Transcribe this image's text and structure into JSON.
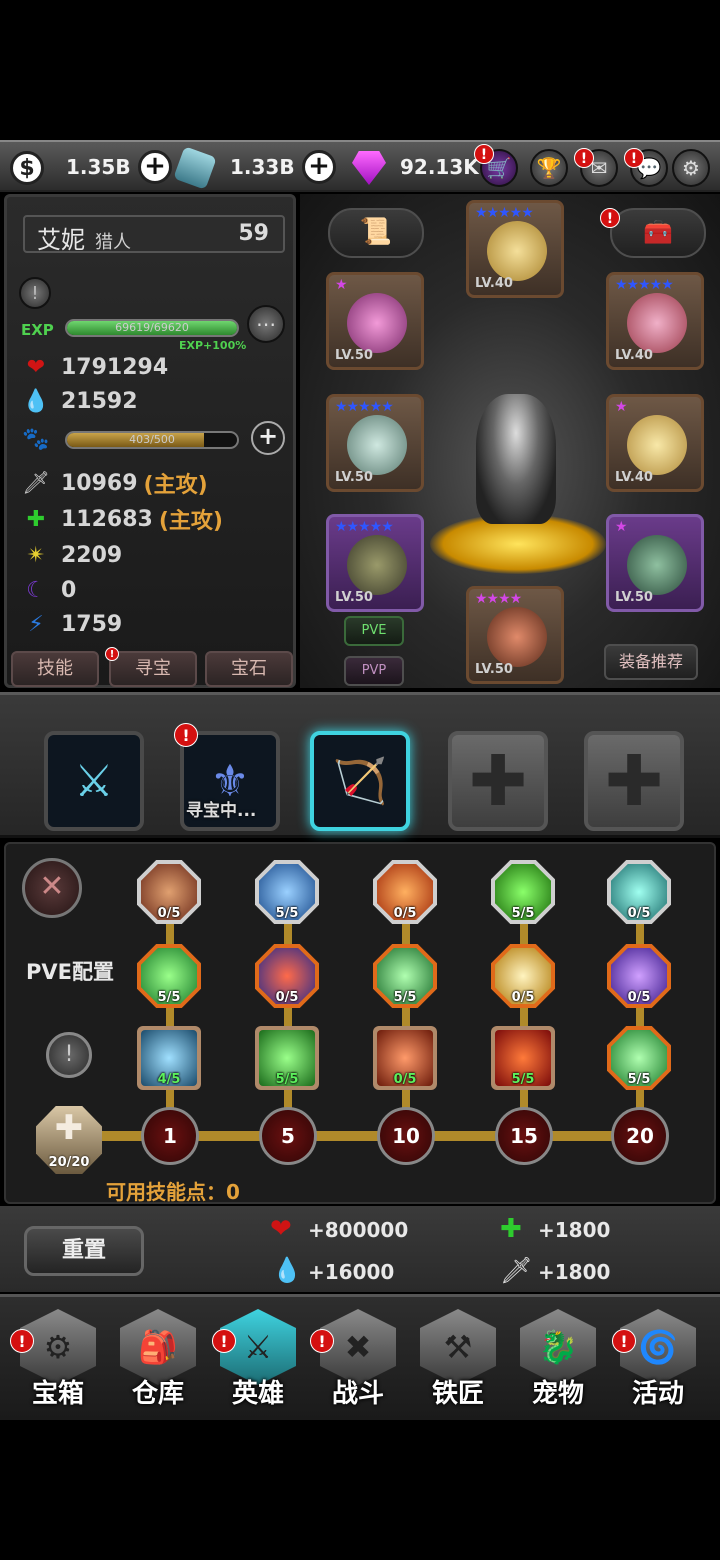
{
  "currency": {
    "gold": "1.35B",
    "crystal": "1.33B",
    "gem": "92.13K"
  },
  "hero": {
    "name": "艾妮",
    "class": "猎人",
    "level": "59",
    "exp_label": "EXP",
    "exp_value": "69619/69620",
    "exp_bonus": "EXP+100%",
    "exp_fraction": 1.0,
    "hp": "1791294",
    "mp": "21592",
    "pet_value": "403/500",
    "pet_fraction": 0.806,
    "attack": "10969",
    "attack_tag": "(主攻)",
    "magic": "112683",
    "magic_tag": "(主攻)",
    "crit": "2209",
    "dark": "0",
    "speed": "1759"
  },
  "stat_tabs": [
    "技能",
    "寻宝",
    "宝石"
  ],
  "equipment": {
    "slots": [
      {
        "lv": "LV.40",
        "stars": "★★★★★"
      },
      {
        "lv": "LV.50",
        "stars": "★"
      },
      {
        "lv": "LV.40",
        "stars": "★★★★★"
      },
      {
        "lv": "LV.50",
        "stars": "★★★★★"
      },
      {
        "lv": "LV.40",
        "stars": "★"
      },
      {
        "lv": "LV.50",
        "stars": "★★★★★"
      },
      {
        "lv": "LV.50",
        "stars": "★"
      },
      {
        "lv": "LV.50",
        "stars": "★★★★"
      }
    ],
    "pve_label": "PVE",
    "pvp_label": "PVP",
    "recommend_label": "装备推荐"
  },
  "hero_slots": {
    "searching_label": "寻宝中..."
  },
  "skills": {
    "config_label": "PVE配置",
    "rows": [
      [
        "0/5",
        "5/5",
        "0/5",
        "5/5",
        "0/5"
      ],
      [
        "5/5",
        "0/5",
        "5/5",
        "0/5",
        "0/5"
      ],
      [
        "4/5",
        "5/5",
        "0/5",
        "5/5",
        "5/5"
      ]
    ],
    "points_total": "20/20",
    "milestones": [
      "1",
      "5",
      "10",
      "15",
      "20"
    ],
    "available_label": "可用技能点：0"
  },
  "bonus": {
    "reset_label": "重置",
    "hp_bonus": "+800000",
    "mp_bonus": "+16000",
    "magic_bonus": "+1800",
    "attack_bonus": "+1800"
  },
  "nav": [
    "宝箱",
    "仓库",
    "英雄",
    "战斗",
    "铁匠",
    "宠物",
    "活动"
  ],
  "colors": {
    "accent": "#3fd3e0",
    "stat_tag": "#e4a23a",
    "alert": "#d41010"
  }
}
